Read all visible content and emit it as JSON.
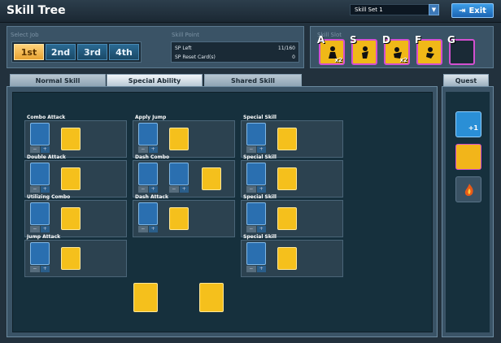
{
  "title": "Skill Tree",
  "skill_set": {
    "selected": "Skill Set 1"
  },
  "exit_label": "Exit",
  "select_job": {
    "label": "Select Job",
    "jobs": [
      "1st",
      "2nd",
      "3rd",
      "4th"
    ],
    "active": "1st"
  },
  "skill_point": {
    "label": "Skill Point",
    "sp_left_label": "SP Left",
    "sp_left_value": "11/160",
    "reset_label": "SP Reset Card(s)",
    "reset_value": "0"
  },
  "skill_slot": {
    "label": "Skill Slot",
    "keys": [
      "A",
      "S",
      "D",
      "F",
      "G"
    ],
    "badges": [
      "x2",
      "",
      "x2",
      "",
      ""
    ]
  },
  "tabs": [
    "Normal Skill",
    "Special Ability",
    "Shared Skill"
  ],
  "active_tab": "Special Ability",
  "quest_tab": "Quest",
  "quest_plus": "+1",
  "groups": [
    "Combo Attack",
    "Apply Jump",
    "Special Skill",
    "Double Attack",
    "Dash Combo",
    "Special Skill",
    "Utilizing Combo",
    "Dash Attack",
    "Special Skill",
    "Jump Attack",
    "Special Skill"
  ],
  "pm_labels": {
    "minus": "−",
    "plus": "+"
  },
  "colors": {
    "accent_gold": "#f5c01c",
    "skill_blue": "#2a6fb0",
    "slot_border": "#d34fd0",
    "panel_bg": "#3a5366"
  }
}
